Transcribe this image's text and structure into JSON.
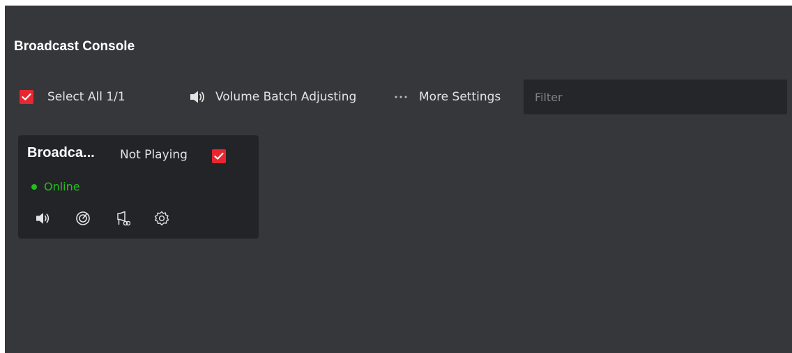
{
  "console": {
    "title": "Broadcast Console"
  },
  "toolbar": {
    "select_all_label": "Select All 1/1",
    "select_all_checked": true,
    "volume_batch_label": "Volume Batch Adjusting",
    "volume_icon": "speaker-icon",
    "more_settings_label": "More Settings",
    "more_icon": "ellipsis-icon",
    "filter_placeholder": "Filter",
    "filter_value": ""
  },
  "devices": [
    {
      "name": "Broadca...",
      "state": "Not Playing",
      "checked": true,
      "status": "Online",
      "actions": [
        "speaker-icon",
        "gauge-icon",
        "broadcast-audio-icon",
        "gear-icon"
      ]
    }
  ],
  "colors": {
    "background": "#36373b",
    "card": "#232428",
    "input": "#24262a",
    "accent": "#e8262f",
    "online": "#21c01c",
    "text": "#e3e3e3"
  }
}
